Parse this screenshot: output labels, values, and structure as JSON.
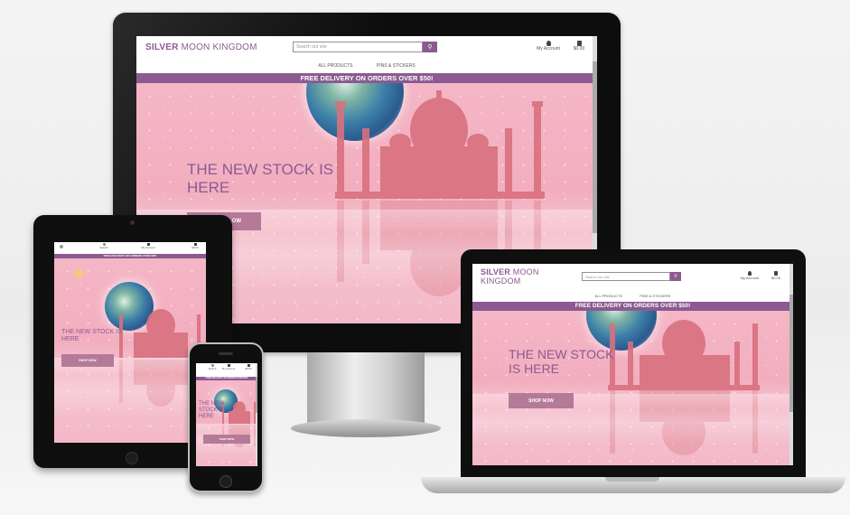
{
  "site": {
    "brand_bold": "SILVER",
    "brand_rest": "MOON KINGDOM",
    "search_placeholder": "Search our site",
    "account_label": "My Account",
    "bag_total": "$0.00",
    "search_label_mobile": "Search",
    "nav": [
      "ALL PRODUCTS",
      "PINS & STICKERS"
    ],
    "banner": "FREE DELIVERY ON ORDERS OVER $50!",
    "headline": "THE NEW STOCK IS HERE",
    "headline_laptop_line1": "THE NEW STOCK",
    "headline_laptop_line2": "IS HERE",
    "headline_desktop_line1": "THE NEW STOCK IS",
    "headline_desktop_line2": "HERE",
    "headline_mobile_line1": "THE NEW",
    "headline_mobile_line2": "STOCK IS",
    "headline_mobile_line3": "HERE",
    "shop_button": "SHOP NOW",
    "desktop_shop_button_visible": "OW"
  },
  "colors": {
    "brand": "#8b5a91",
    "hero_pink": "#f3b3c4",
    "taj": "#d9707e",
    "button": "#b57a98"
  }
}
